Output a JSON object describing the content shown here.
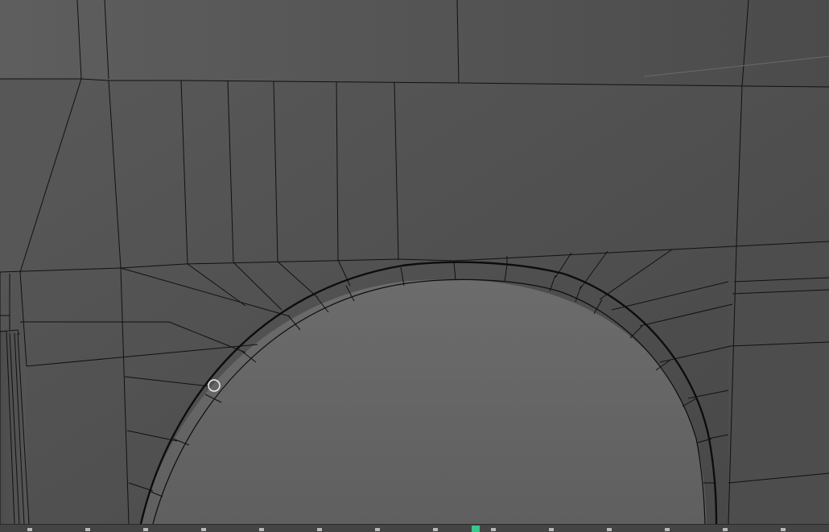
{
  "viewport": {
    "label": "",
    "background": "#515151",
    "wire_color": "#111111",
    "selected_edge_color": "#0c0c0c",
    "hole_color": "#676767",
    "cursor_icon": "brush-circle-icon"
  },
  "timeline": {
    "background": "#444444",
    "tick_color": "#b8b8b8",
    "playhead_color": "#38c68a",
    "tick_count": 14,
    "current_frame_label": ""
  }
}
